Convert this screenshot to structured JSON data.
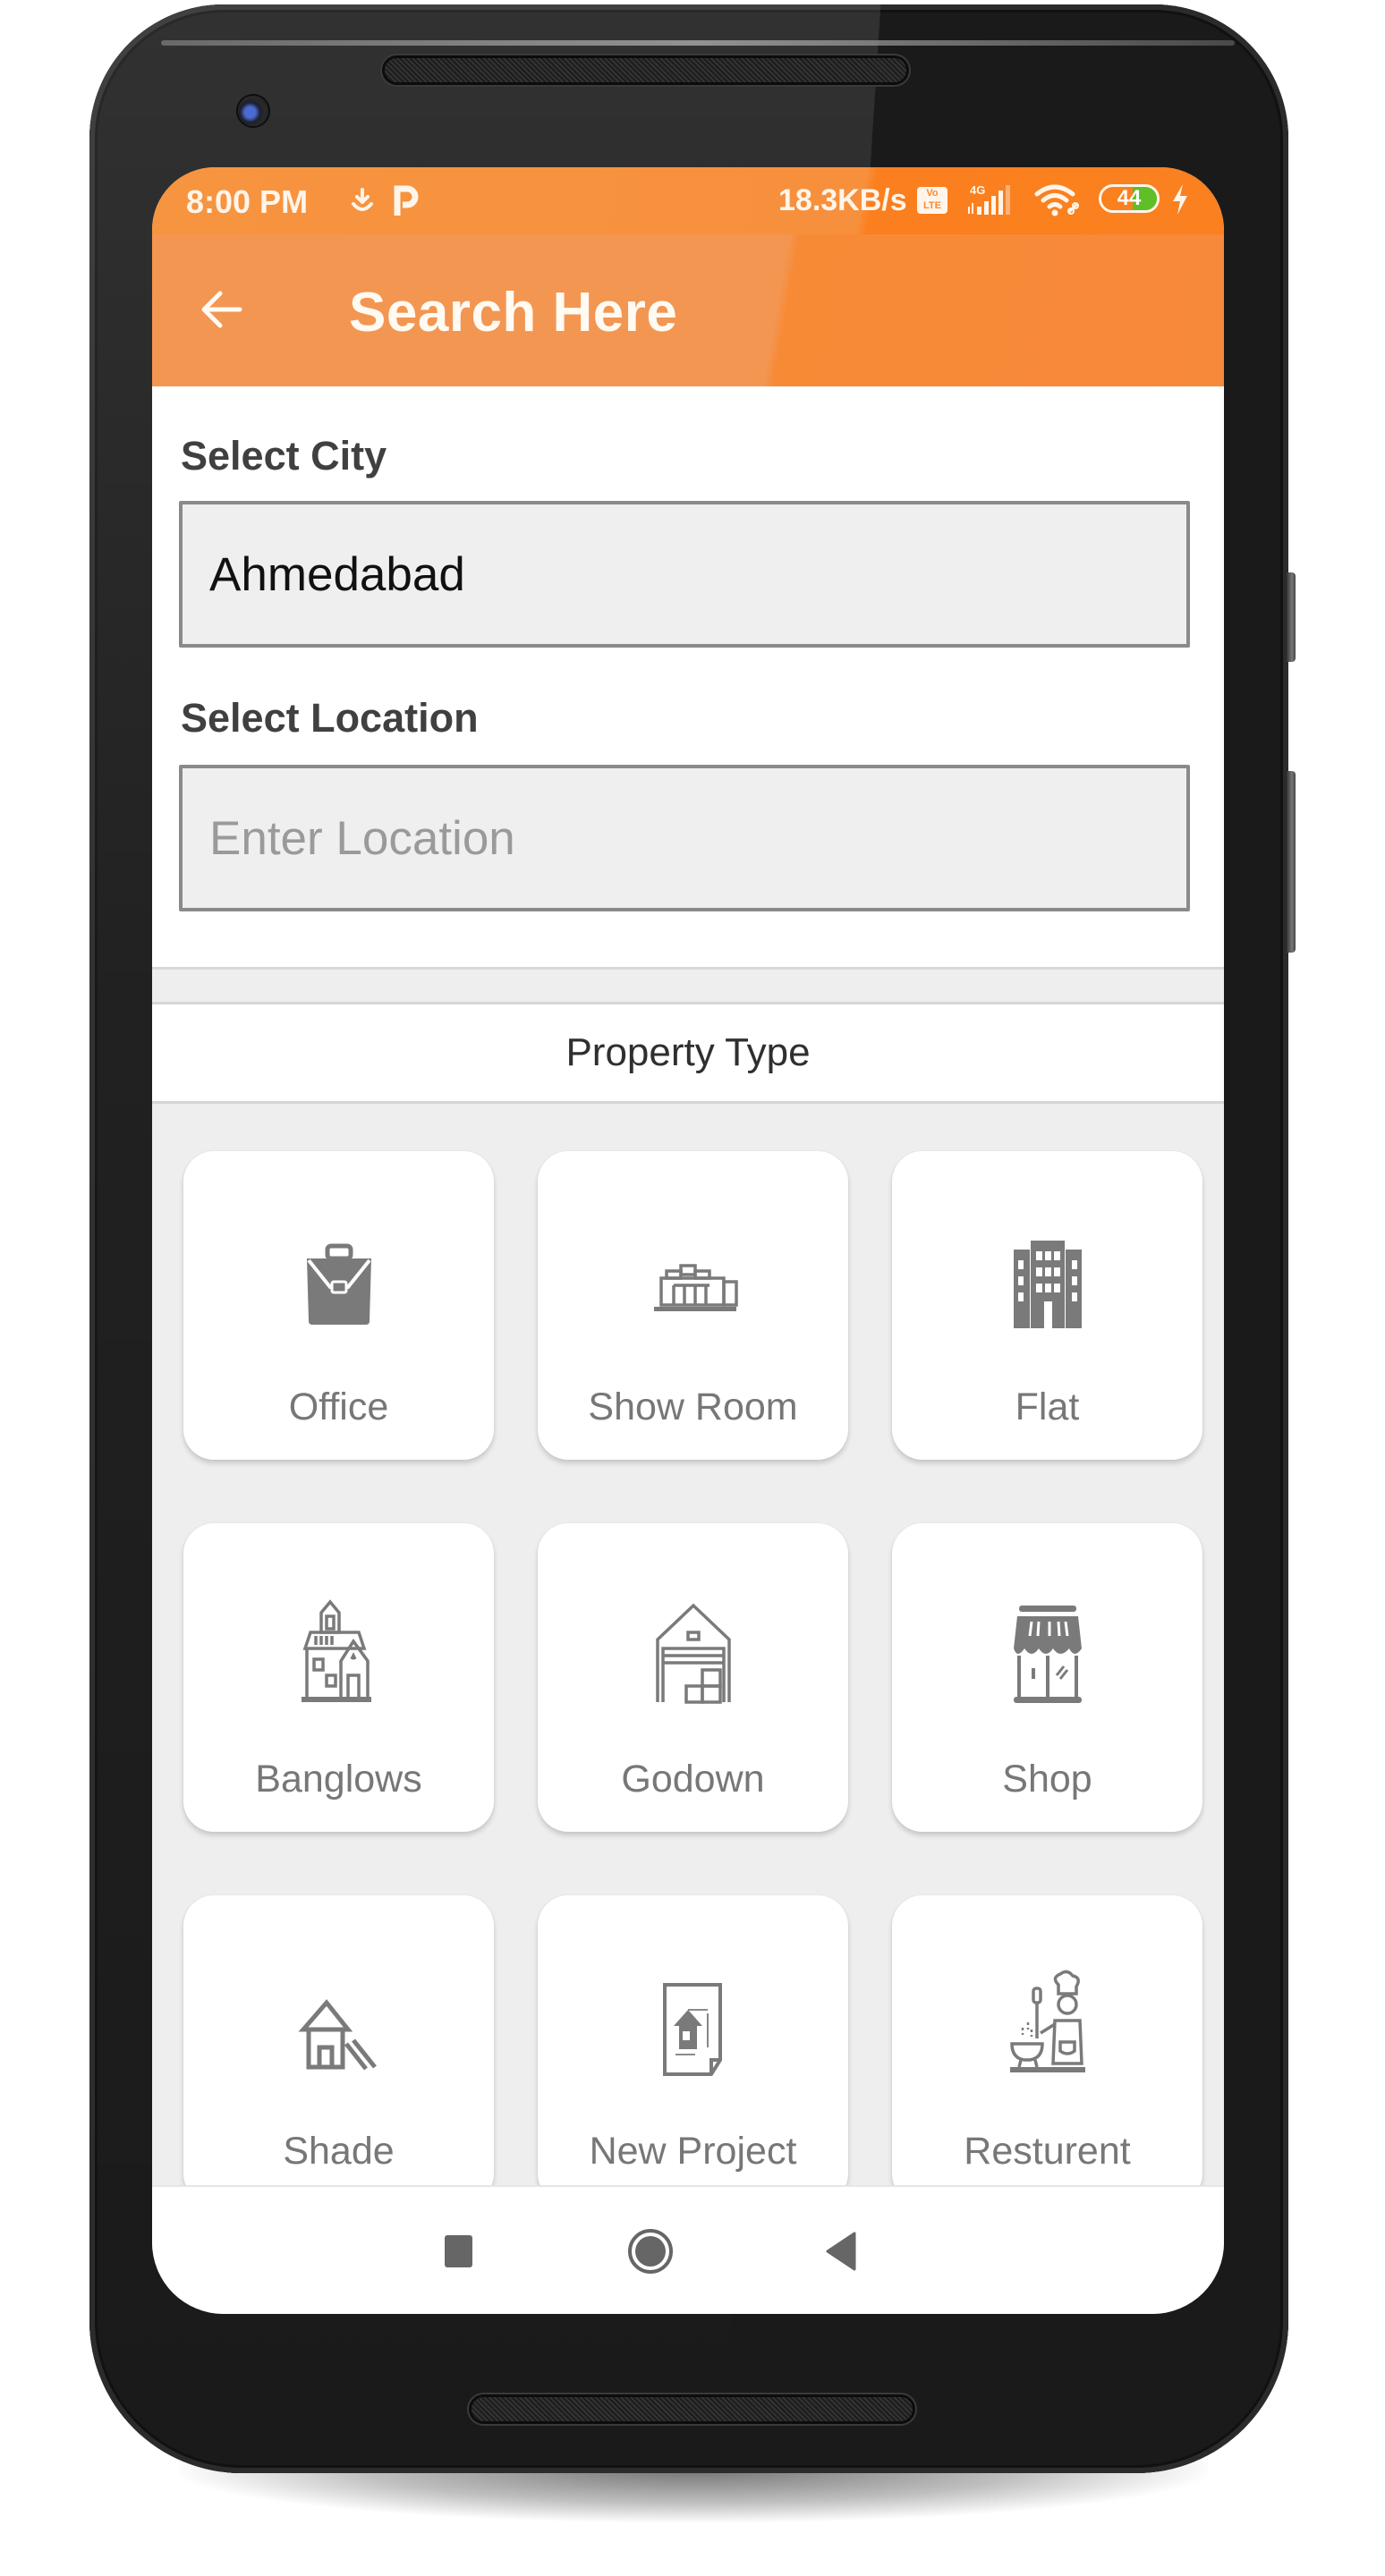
{
  "status_bar": {
    "time": "8:00 PM",
    "left_icons": [
      "download-icon",
      "p-app-icon"
    ],
    "net_speed": "18.3KB/s",
    "volte_label": "Vo LTE",
    "network_type": "4G",
    "battery_level": "44",
    "battery_fraction": 0.44,
    "charging": true
  },
  "toolbar": {
    "title": "Search Here",
    "back_icon": "arrow-left-icon",
    "color": "#f39652"
  },
  "form": {
    "city_label": "Select City",
    "city_value": "Ahmedabad",
    "location_label": "Select Location",
    "location_value": "",
    "location_placeholder": "Enter Location"
  },
  "property_section": {
    "title": "Property Type",
    "items": [
      {
        "label": "Office",
        "icon": "briefcase-icon"
      },
      {
        "label": "Show Room",
        "icon": "showroom-icon"
      },
      {
        "label": "Flat",
        "icon": "building-icon"
      },
      {
        "label": "Banglows",
        "icon": "bungalow-icon"
      },
      {
        "label": "Godown",
        "icon": "warehouse-icon"
      },
      {
        "label": "Shop",
        "icon": "shop-icon"
      },
      {
        "label": "Shade",
        "icon": "shed-icon"
      },
      {
        "label": "New Project",
        "icon": "blueprint-icon"
      },
      {
        "label": "Resturent",
        "icon": "chef-icon"
      }
    ]
  },
  "nav_bar": {
    "buttons": [
      "recents-icon",
      "home-icon",
      "back-triangle-icon"
    ]
  },
  "colors": {
    "accent": "#f7903c",
    "icon_gray": "#7a7a7a",
    "background": "#eeeeee"
  }
}
